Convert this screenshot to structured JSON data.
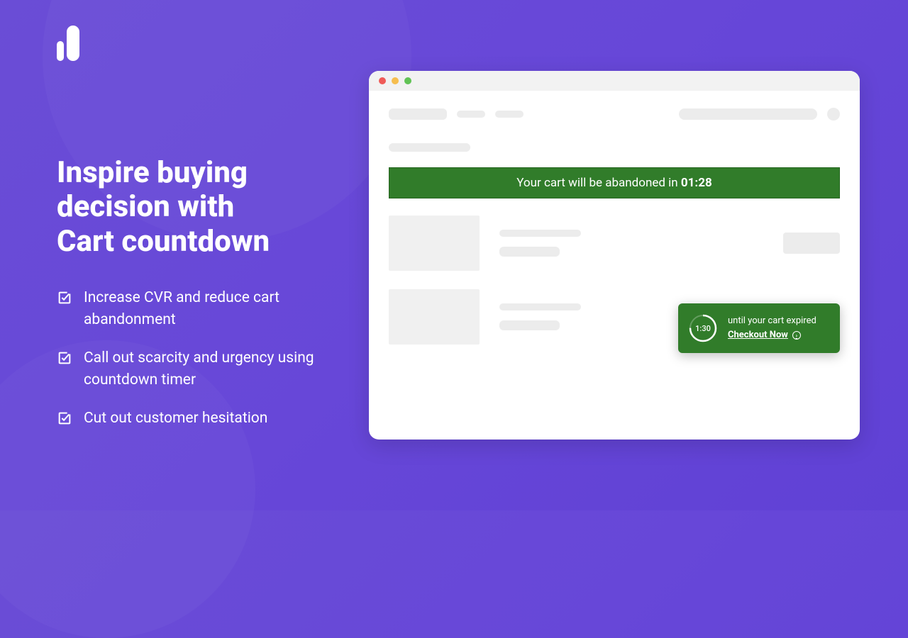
{
  "hero": {
    "title_line1": "Inspire buying",
    "title_line2": "decision with",
    "title_line3": "Cart countdown"
  },
  "benefits": {
    "item1": "Increase CVR and reduce cart abandonment",
    "item2": "Call out scarcity and urgency using countdown timer",
    "item3": "Cut out customer hesitation"
  },
  "banner": {
    "prefix": "Your cart will be abandoned in ",
    "time": "01:28"
  },
  "popup": {
    "timer_value": "1:30",
    "until_text": "until your cart expired",
    "cta_label": "Checkout Now"
  }
}
